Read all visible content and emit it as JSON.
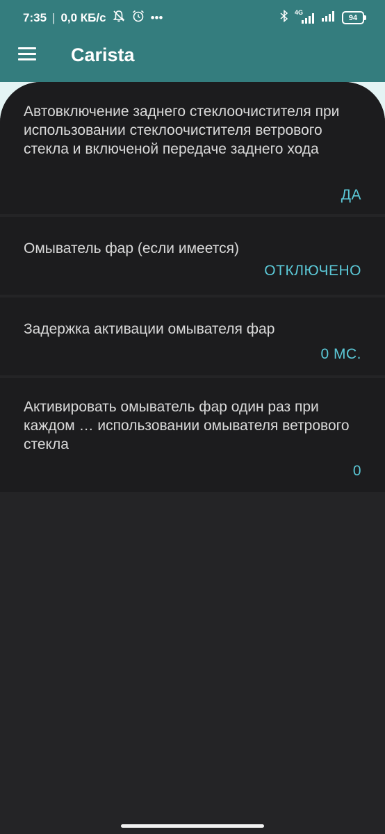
{
  "status_bar": {
    "time": "7:35",
    "separator": "|",
    "network_speed": "0,0 КБ/с",
    "more": "•••",
    "network_type": "4G",
    "battery": "94"
  },
  "app_bar": {
    "title": "Carista"
  },
  "settings": [
    {
      "label": "Автовключение заднего стеклоочистителя при использовании стеклоочистителя ветрового стекла и включеной передаче заднего хода",
      "value": "ДА"
    },
    {
      "label": "Омыватель фар (если имеется)",
      "value": "ОТКЛЮЧЕНО"
    },
    {
      "label": "Задержка активации омывателя фар",
      "value": "0 МС."
    },
    {
      "label": "Активировать омыватель фар один раз при каждом … использовании омывателя ветрового стекла",
      "value": "0"
    }
  ],
  "colors": {
    "header": "#347d7e",
    "accent": "#5bc8d7",
    "card": "#1c1c1e",
    "background": "#242426"
  },
  "icons": [
    "menu-icon",
    "muted-notification-icon",
    "alarm-icon",
    "bluetooth-icon",
    "signal-icon",
    "battery-icon"
  ]
}
